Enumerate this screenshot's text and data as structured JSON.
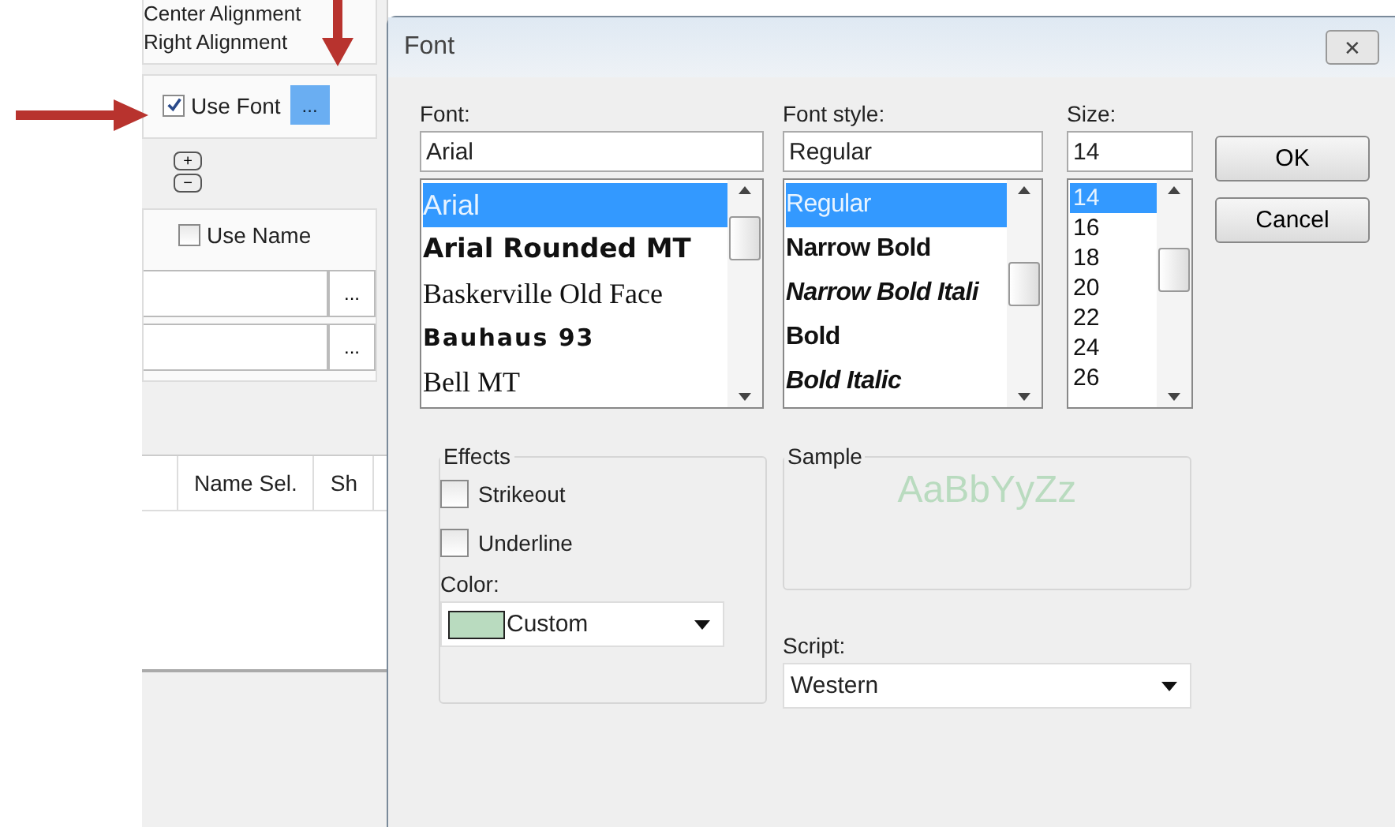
{
  "background_panel": {
    "alignment_options": [
      "Center Alignment",
      "Right Alignment"
    ],
    "use_font": {
      "label": "Use Font",
      "checked": true,
      "button": "..."
    },
    "stepper": {
      "plus": "+",
      "minus": "−"
    },
    "use_name": {
      "label": "Use Name",
      "checked": false
    },
    "fields": [
      {
        "button": "..."
      },
      {
        "button": "..."
      }
    ],
    "table": {
      "columns": [
        "Name Sel.",
        "Sh"
      ]
    }
  },
  "dialog": {
    "title": "Font",
    "close": "✕",
    "font": {
      "label": "Font:",
      "value": "Arial",
      "items": [
        {
          "label": "Arial",
          "kind": "sans",
          "selected": true
        },
        {
          "label": "Arial Rounded MT",
          "kind": "rounded",
          "selected": false
        },
        {
          "label": "Baskerville Old Face",
          "kind": "serif",
          "selected": false
        },
        {
          "label": "Bauhaus 93",
          "kind": "display",
          "selected": false
        },
        {
          "label": "Bell MT",
          "kind": "serif",
          "selected": false
        }
      ]
    },
    "font_style": {
      "label": "Font style:",
      "value": "Regular",
      "items": [
        {
          "label": "Regular",
          "kind": "regular",
          "selected": true
        },
        {
          "label": "Narrow Bold",
          "kind": "bold",
          "selected": false
        },
        {
          "label": "Narrow Bold Itali",
          "kind": "italic",
          "selected": false
        },
        {
          "label": "Bold",
          "kind": "bold",
          "selected": false
        },
        {
          "label": "Bold Italic",
          "kind": "italic",
          "selected": false
        }
      ]
    },
    "size": {
      "label": "Size:",
      "value": "14",
      "items": [
        {
          "label": "14",
          "selected": true
        },
        {
          "label": "16",
          "selected": false
        },
        {
          "label": "18",
          "selected": false
        },
        {
          "label": "20",
          "selected": false
        },
        {
          "label": "22",
          "selected": false
        },
        {
          "label": "24",
          "selected": false
        },
        {
          "label": "26",
          "selected": false
        }
      ]
    },
    "buttons": [
      "OK",
      "Cancel"
    ],
    "effects": {
      "title": "Effects",
      "options": [
        {
          "label": "Strikeout",
          "checked": false
        },
        {
          "label": "Underline",
          "checked": false
        }
      ],
      "color_label": "Color:",
      "color": {
        "value": "Custom",
        "color": "#b9dbbf"
      }
    },
    "sample": {
      "title": "Sample",
      "text": "AaBbYyZz"
    },
    "script": {
      "label": "Script:",
      "value": "Western"
    }
  }
}
